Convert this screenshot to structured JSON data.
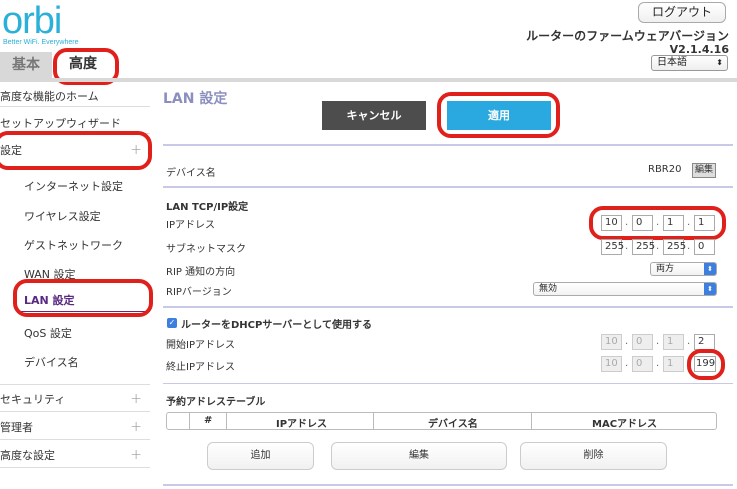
{
  "header": {
    "logo": "orbi",
    "tagline": "Better WiFi. Everywhere",
    "logout_label": "ログアウト",
    "firmware_label": "ルーターのファームウェアバージョン",
    "firmware_version": "V2.1.4.16",
    "language": "日本語"
  },
  "tabs": {
    "basic": "基本",
    "advanced": "高度"
  },
  "sidebar": {
    "home": "高度な機能のホーム",
    "wizard": "セットアップウィザード",
    "settings": "設定",
    "sub": {
      "internet": "インターネット設定",
      "wireless": "ワイヤレス設定",
      "guest": "ゲストネットワーク",
      "wan": "WAN 設定",
      "lan": "LAN 設定",
      "qos": "QoS 設定",
      "device_name": "デバイス名"
    },
    "security": "セキュリティ",
    "admin": "管理者",
    "advanced_settings": "高度な設定",
    "plus": "+"
  },
  "main": {
    "title": "LAN 設定",
    "cancel_label": "キャンセル",
    "apply_label": "適用",
    "device_name_label": "デバイス名",
    "device_name_value": "RBR20",
    "edit_label": "編集",
    "tcpip_header": "LAN TCP/IP設定",
    "ip_label": "IPアドレス",
    "ip": [
      "10",
      "0",
      "1",
      "1"
    ],
    "subnet_label": "サブネットマスク",
    "subnet": [
      "255",
      "255",
      "255",
      "0"
    ],
    "rip_dir_label": "RIP 通知の方向",
    "rip_dir_value": "両方",
    "rip_ver_label": "RIPバージョン",
    "rip_ver_value": "無効",
    "dhcp_label": "ルーターをDHCPサーバーとして使用する",
    "start_label": "開始IPアドレス",
    "start_ip": [
      "10",
      "0",
      "1",
      "2"
    ],
    "end_label": "終止IPアドレス",
    "end_ip": [
      "10",
      "0",
      "1",
      "199"
    ],
    "reserved_header": "予約アドレステーブル",
    "table_headers": [
      "#",
      "IPアドレス",
      "デバイス名",
      "MACアドレス"
    ],
    "add_label": "追加",
    "edit_btn_label": "編集",
    "delete_label": "削除"
  },
  "colors": {
    "accent": "#29a9e0",
    "highlight": "#e0201b",
    "active_nav": "#5a2a82"
  }
}
